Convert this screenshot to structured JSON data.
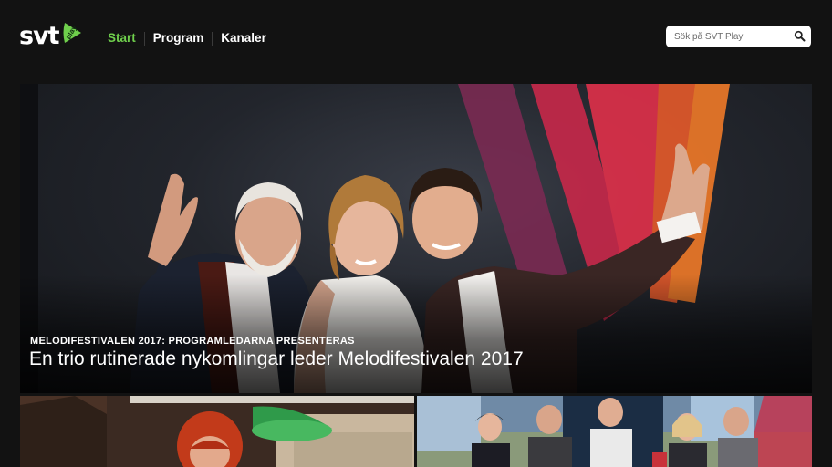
{
  "brand": {
    "logo_text": "svt",
    "logo_badge": "play",
    "accent_color": "#6fcf4c"
  },
  "nav": {
    "items": [
      {
        "label": "Start",
        "active": true
      },
      {
        "label": "Program",
        "active": false
      },
      {
        "label": "Kanaler",
        "active": false
      }
    ]
  },
  "search": {
    "placeholder": "Sök på SVT Play",
    "value": "",
    "icon": "search-icon"
  },
  "hero": {
    "kicker": "MELODIFESTIVALEN 2017: PROGRAMLEDARNA PRESENTERAS",
    "title": "En trio rutinerade nykomlingar leder Melodifestivalen 2017"
  },
  "thumbnails": [
    {
      "name": "thumbnail-drama"
    },
    {
      "name": "thumbnail-studio"
    }
  ]
}
